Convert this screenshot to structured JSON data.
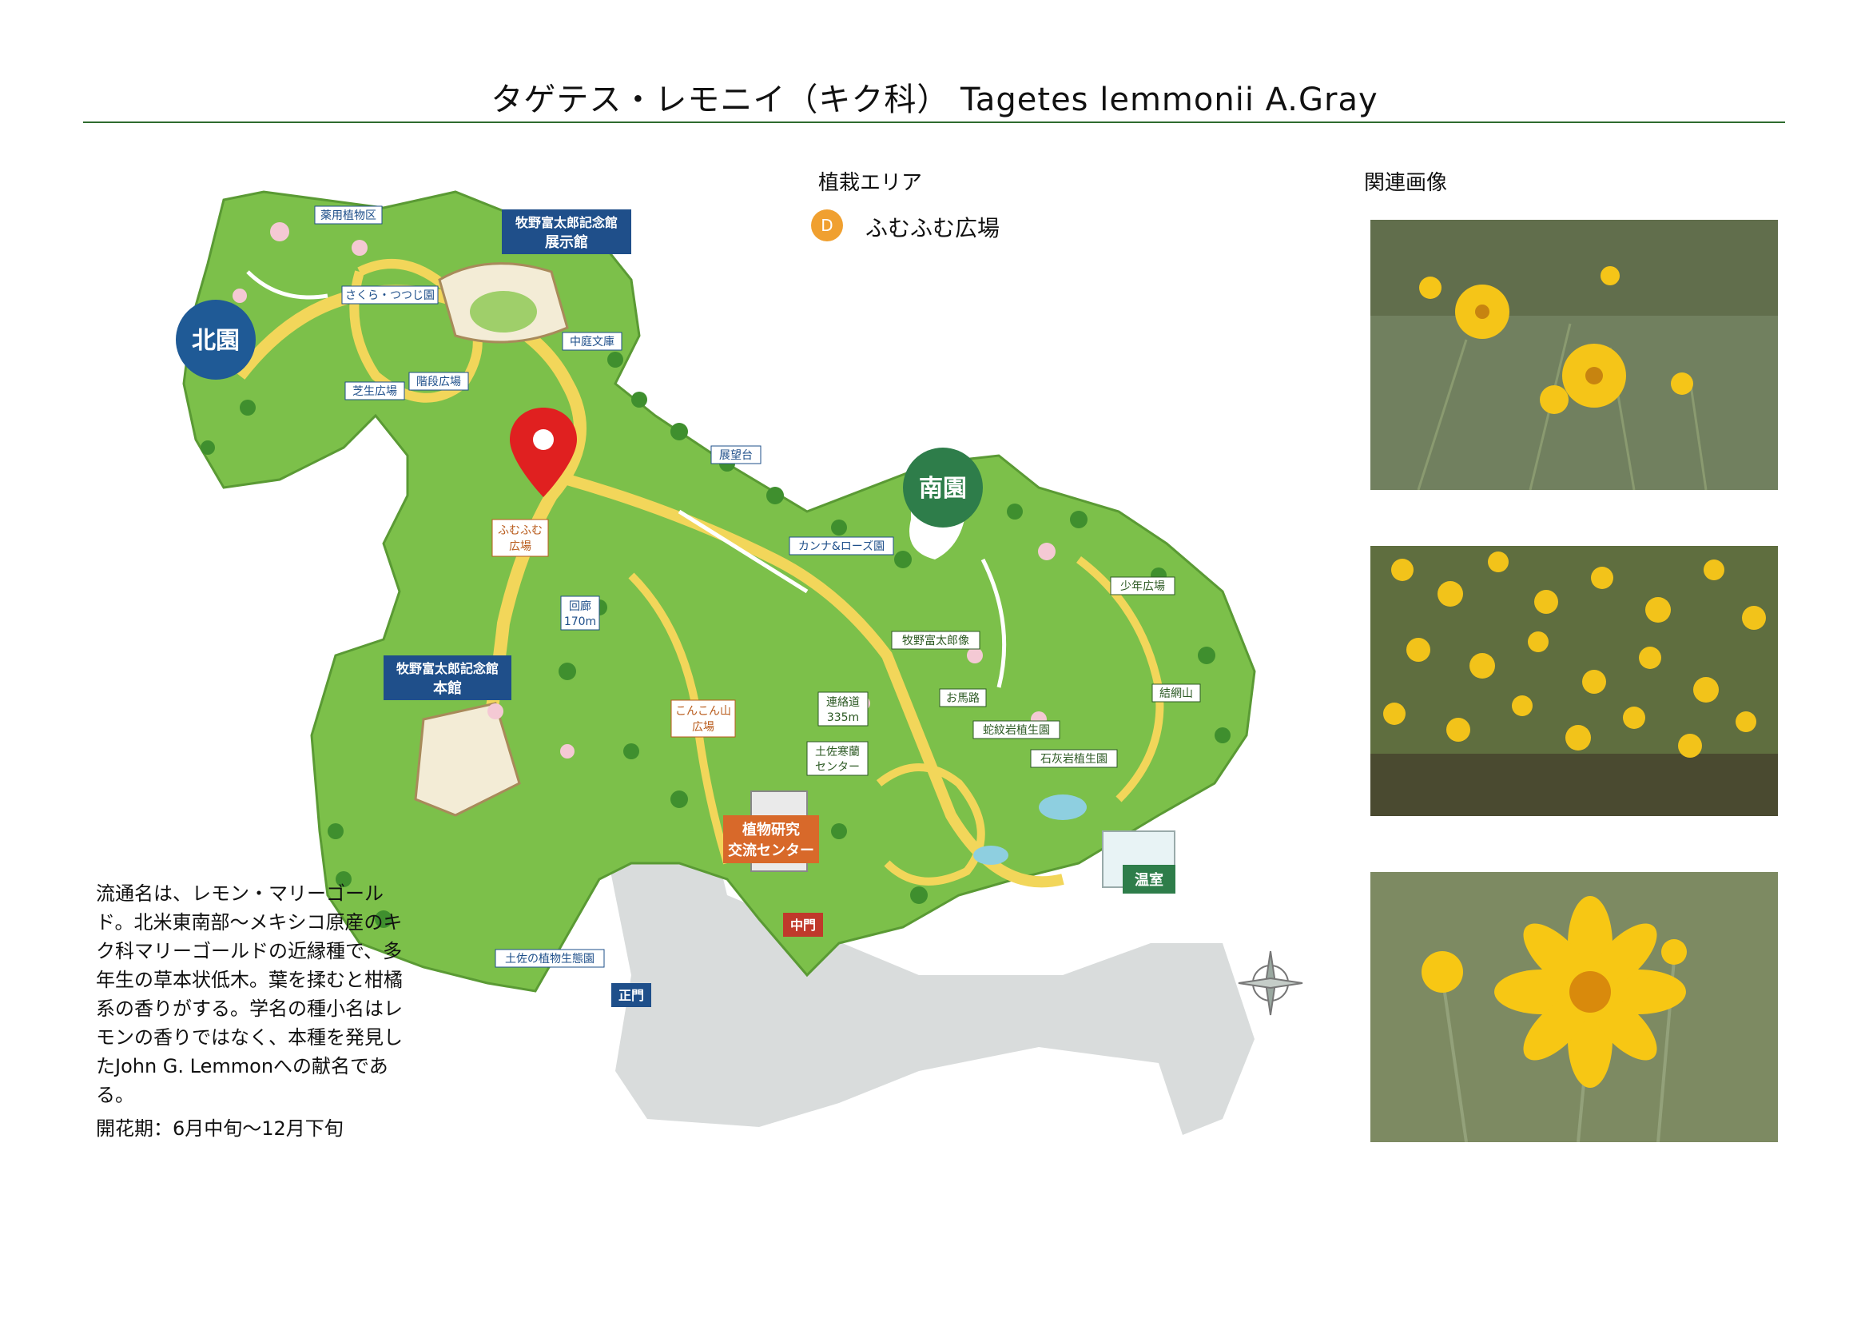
{
  "title": "タゲテス・レモニイ（キク科） Tagetes lemmonii A.Gray",
  "planting_area": {
    "heading": "植栽エリア",
    "code": "D",
    "name": "ふむふむ広場",
    "color": "#f0a030"
  },
  "related_images": {
    "heading": "関連画像",
    "photos": [
      "yellow-flower-cluster-photo",
      "yellow-flower-field-photo",
      "yellow-flower-closeup-photo"
    ]
  },
  "description": "流通名は、レモン・マリーゴールド。北米東南部～メキシコ原産のキク科マリーゴールドの近縁種で、多年生の草本状低木。葉を揉むと柑橘系の香りがする。学名の種小名はレモンの香りではなく、本種を発見したJohn G. Lemmonへの献名である。",
  "bloom_period": "開花期：6月中旬～12月下旬",
  "map": {
    "zones": {
      "north": "北園",
      "south": "南園"
    },
    "zone_color": "#1f5a96",
    "south_color": "#2e7d4a",
    "labels": {
      "medicinal": "薬用植物区",
      "museum_label_1": "牧野富太郎記念館",
      "museum_label_2": "展示館",
      "sakura": "さくら・つつじ園",
      "courtyard": "中庭文庫",
      "lawn": "芝生広場",
      "stairs": "階段広場",
      "observatory": "展望台",
      "fumufumu": "ふむふむ",
      "fumufumu2": "広場",
      "canna": "カンナ&ローズ園",
      "corridor": "回廊",
      "corridor_len": "170m",
      "main_hall_1": "牧野富太郎記念館",
      "main_hall_2": "本館",
      "makino_statue": "牧野富太郎像",
      "konkon_1": "こんこん山",
      "konkon_2": "広場",
      "connecting": "連絡道",
      "connecting_len": "335m",
      "horse_path": "お馬路",
      "serpentine": "蛇紋岩植生園",
      "tosa_center_1": "土佐寒蘭",
      "tosa_center_2": "センター",
      "limestone": "石灰岩植生園",
      "research_1": "植物研究",
      "research_2": "交流センター",
      "boys_plaza": "少年広場",
      "kekken": "結網山",
      "greenhouse": "温室",
      "middle_gate": "中門",
      "tosa_ecology": "土佐の植物生態園",
      "main_gate": "正門"
    },
    "colors": {
      "green": "#7cc04a",
      "path": "#f2d65a",
      "road": "#d9dcdc",
      "pin": "#e02020"
    }
  }
}
